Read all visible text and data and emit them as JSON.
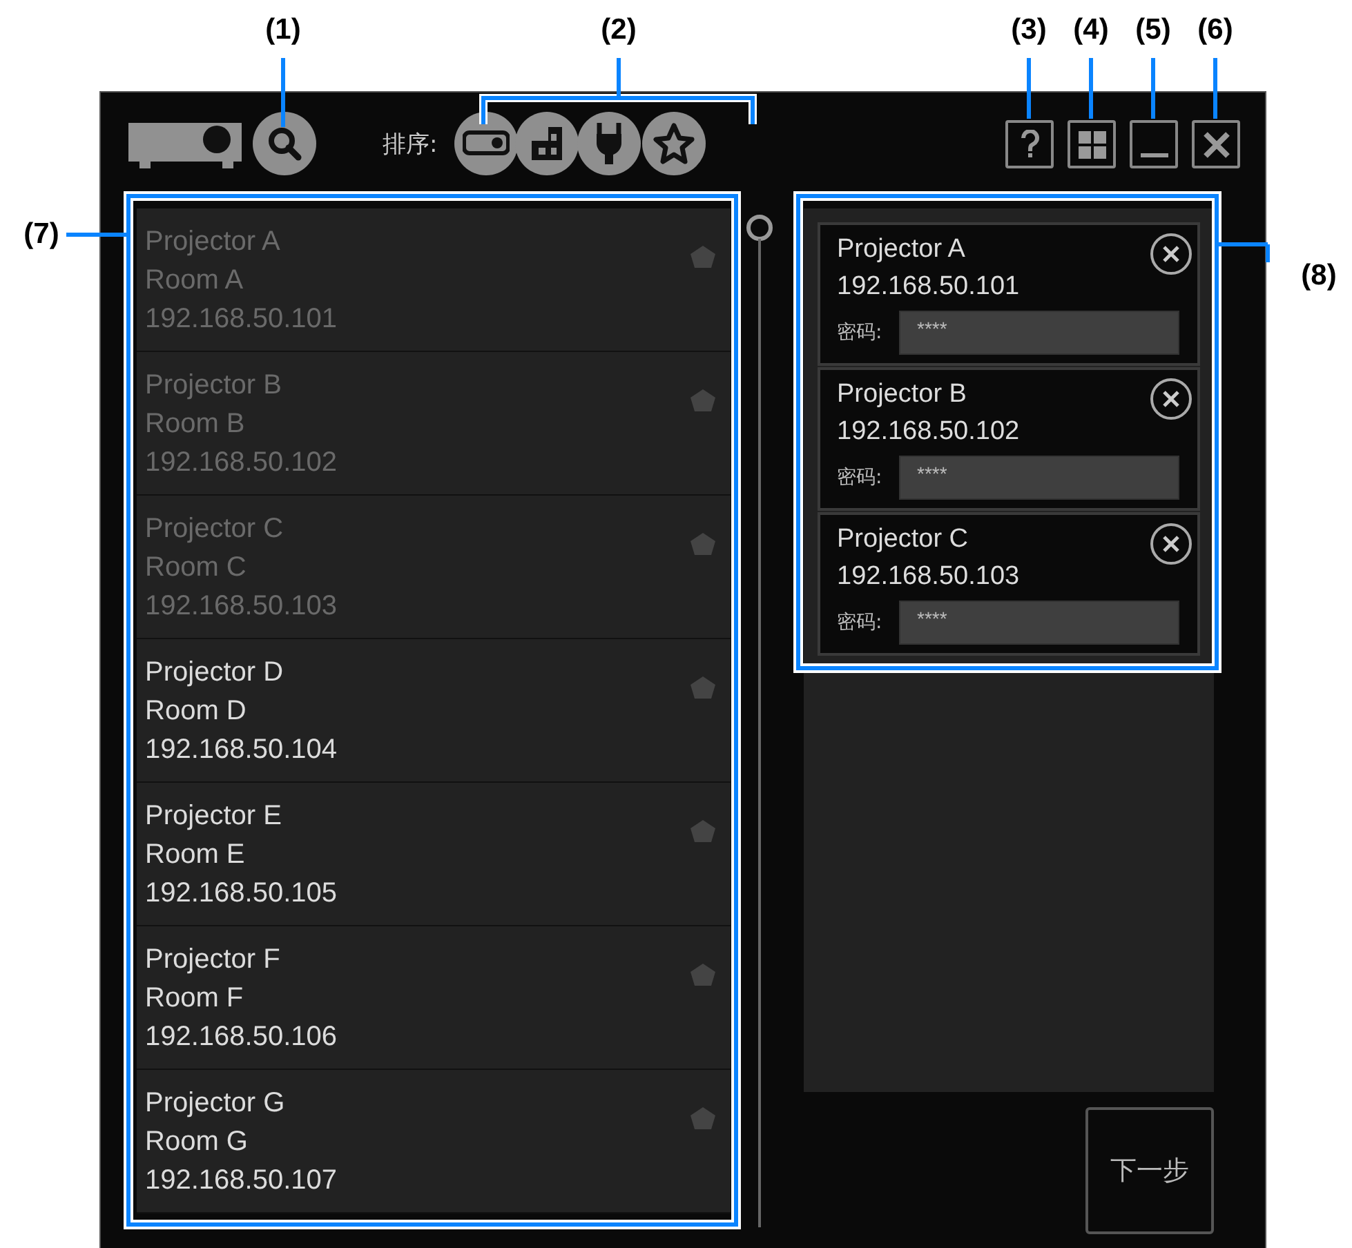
{
  "callouts": [
    {
      "label": "(1)"
    },
    {
      "label": "(2)"
    },
    {
      "label": "(3)"
    },
    {
      "label": "(4)"
    },
    {
      "label": "(5)"
    },
    {
      "label": "(6)"
    },
    {
      "label": "(7)"
    },
    {
      "label": "(8)"
    }
  ],
  "toolbar": {
    "sort_label": "排序:"
  },
  "projectors": [
    {
      "name": "Projector A",
      "room": "Room A",
      "ip": "192.168.50.101",
      "disabled": true
    },
    {
      "name": "Projector B",
      "room": "Room B",
      "ip": "192.168.50.102",
      "disabled": true
    },
    {
      "name": "Projector C",
      "room": "Room C",
      "ip": "192.168.50.103",
      "disabled": true
    },
    {
      "name": "Projector D",
      "room": "Room D",
      "ip": "192.168.50.104",
      "disabled": false
    },
    {
      "name": "Projector E",
      "room": "Room E",
      "ip": "192.168.50.105",
      "disabled": false
    },
    {
      "name": "Projector F",
      "room": "Room F",
      "ip": "192.168.50.106",
      "disabled": false
    },
    {
      "name": "Projector G",
      "room": "Room G",
      "ip": "192.168.50.107",
      "disabled": false
    }
  ],
  "selected": [
    {
      "name": "Projector A",
      "ip": "192.168.50.101",
      "password_label": "密码:",
      "password": "****"
    },
    {
      "name": "Projector B",
      "ip": "192.168.50.102",
      "password_label": "密码:",
      "password": "****"
    },
    {
      "name": "Projector C",
      "ip": "192.168.50.103",
      "password_label": "密码:",
      "password": "****"
    }
  ],
  "next_button": "下一步"
}
